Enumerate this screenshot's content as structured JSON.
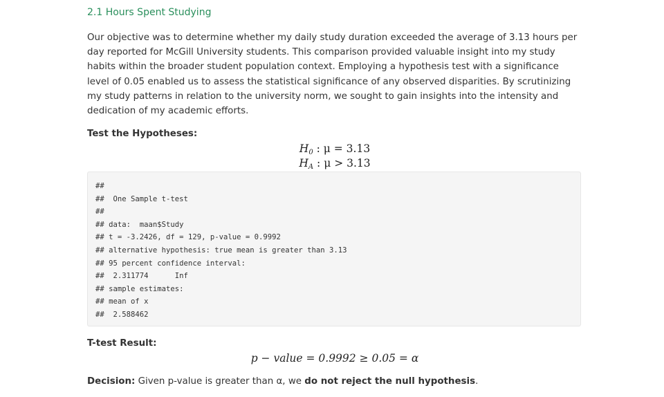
{
  "section": {
    "heading": "2.1 Hours Spent Studying",
    "paragraph": "Our objective was to determine whether my daily study duration exceeded the average of 3.13 hours per day reported for McGill University students. This comparison provided valuable insight into my study habits within the broader student population context. Employing a hypothesis test with a significance level of 0.05 enabled us to assess the statistical significance of any observed disparities. By scrutinizing my study patterns in relation to the university norm, we sought to gain insights into the intensity and dedication of my academic efforts."
  },
  "hypotheses": {
    "label": "Test the Hypotheses:",
    "h0": {
      "symbol": "H",
      "sub": "0",
      "rel": " : μ = 3.13"
    },
    "ha": {
      "symbol": "H",
      "sub": "A",
      "rel": " : μ > 3.13"
    }
  },
  "code_output": {
    "lines": [
      "##",
      "##  One Sample t-test",
      "##",
      "## data:  maan$Study",
      "## t = -3.2426, df = 129, p-value = 0.9992",
      "## alternative hypothesis: true mean is greater than 3.13",
      "## 95 percent confidence interval:",
      "##  2.311774      Inf",
      "## sample estimates:",
      "## mean of x",
      "##  2.588462"
    ]
  },
  "result": {
    "label": "T-test Result:",
    "formula": "p − value = 0.9992 ≥ 0.05 = α"
  },
  "decision": {
    "label": "Decision:",
    "text": " Given p-value is greater than α, we ",
    "emphasis": "do not reject the null hypothesis",
    "end": "."
  }
}
